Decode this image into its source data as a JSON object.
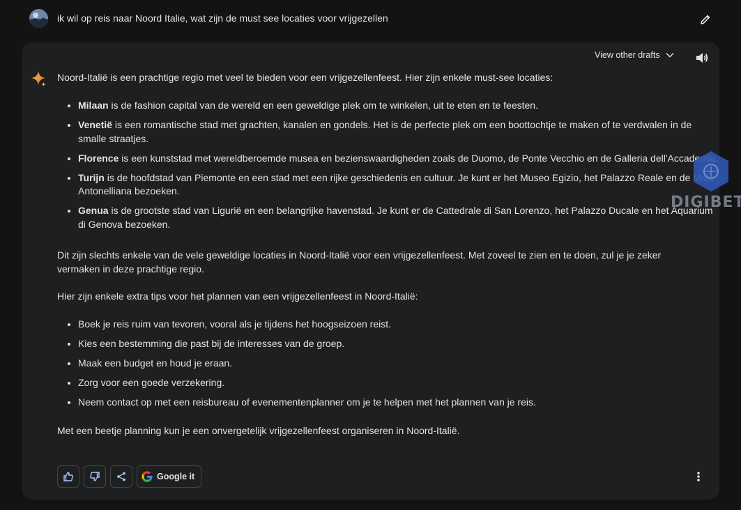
{
  "prompt": {
    "text": "ik wil op reis naar Noord Italie, wat zijn de must see locaties voor vrijgezellen",
    "avatar_icon": "user-avatar",
    "edit_icon": "pencil-icon"
  },
  "response": {
    "drafts_label": "View other drafts",
    "intro": "Noord-Italië is een prachtige regio met veel te bieden voor een vrijgezellenfeest. Hier zijn enkele must-see locaties:",
    "locations": [
      {
        "name": "Milaan",
        "text": " is de fashion capital van de wereld en een geweldige plek om te winkelen, uit te eten en te feesten."
      },
      {
        "name": "Venetië",
        "text": " is een romantische stad met grachten, kanalen en gondels. Het is de perfecte plek om een boottochtje te maken of te verdwalen in de smalle straatjes."
      },
      {
        "name": "Florence",
        "text": " is een kunststad met wereldberoemde musea en bezienswaardigheden zoals de Duomo, de Ponte Vecchio en de Galleria dell'Accademia."
      },
      {
        "name": "Turijn",
        "text": " is de hoofdstad van Piemonte en een stad met een rijke geschiedenis en cultuur. Je kunt er het Museo Egizio, het Palazzo Reale en de Mole Antonelliana bezoeken."
      },
      {
        "name": "Genua",
        "text": " is de grootste stad van Ligurië en een belangrijke havenstad. Je kunt er de Cattedrale di San Lorenzo, het Palazzo Ducale en het Aquarium di Genova bezoeken."
      }
    ],
    "summary": "Dit zijn slechts enkele van de vele geweldige locaties in Noord-Italië voor een vrijgezellenfeest. Met zoveel te zien en te doen, zul je je zeker vermaken in deze prachtige regio.",
    "tips_intro": "Hier zijn enkele extra tips voor het plannen van een vrijgezellenfeest in Noord-Italië:",
    "tips": [
      "Boek je reis ruim van tevoren, vooral als je tijdens het hoogseizoen reist.",
      "Kies een bestemming die past bij de interesses van de groep.",
      "Maak een budget en houd je eraan.",
      "Zorg voor een goede verzekering.",
      "Neem contact op met een reisbureau of evenementenplanner om je te helpen met het plannen van je reis."
    ],
    "outro": "Met een beetje planning kun je een onvergetelijk vrijgezellenfeest organiseren in Noord-Italië."
  },
  "actions": {
    "google_label": "Google it",
    "icons": [
      "thumbs-up-icon",
      "thumbs-down-icon",
      "share-icon",
      "google-icon",
      "more-vert-icon"
    ]
  },
  "watermark": {
    "text": "DIGIBETE"
  },
  "colors": {
    "background": "#131314",
    "card": "#1e1f20",
    "text": "#e3e3e3",
    "button_border": "#444746"
  }
}
